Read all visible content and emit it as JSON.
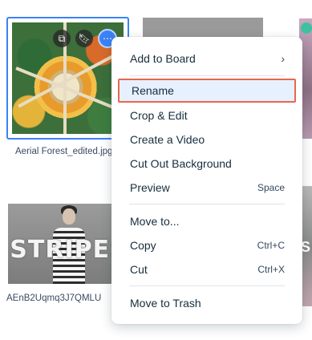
{
  "media": [
    {
      "caption": "Aerial Forest_edited.jpg",
      "selected": true
    },
    {
      "caption": "AEnB2Uqmq3J7QMLU",
      "overlay_text": "STRIPES"
    }
  ],
  "right_partial_letters": [
    "S",
    "S"
  ],
  "thumb_actions": {
    "duplicate_icon": "copy-icon",
    "bookmark_icon": "bookmark-icon",
    "more_icon": "more-icon"
  },
  "menu": {
    "items": [
      {
        "label": "Add to Board",
        "submenu": true
      },
      {
        "label": "Rename",
        "highlighted": true
      },
      {
        "label": "Crop & Edit"
      },
      {
        "label": "Create a Video"
      },
      {
        "label": "Cut Out Background"
      },
      {
        "label": "Preview",
        "shortcut": "Space"
      },
      {
        "label": "Move to..."
      },
      {
        "label": "Copy",
        "shortcut": "Ctrl+C"
      },
      {
        "label": "Cut",
        "shortcut": "Ctrl+X"
      },
      {
        "label": "Move to Trash"
      }
    ]
  },
  "colors": {
    "accent": "#3b82f6",
    "highlight_border": "#e7674f",
    "highlight_bg": "#e7f0ff",
    "text": "#162d3d"
  }
}
